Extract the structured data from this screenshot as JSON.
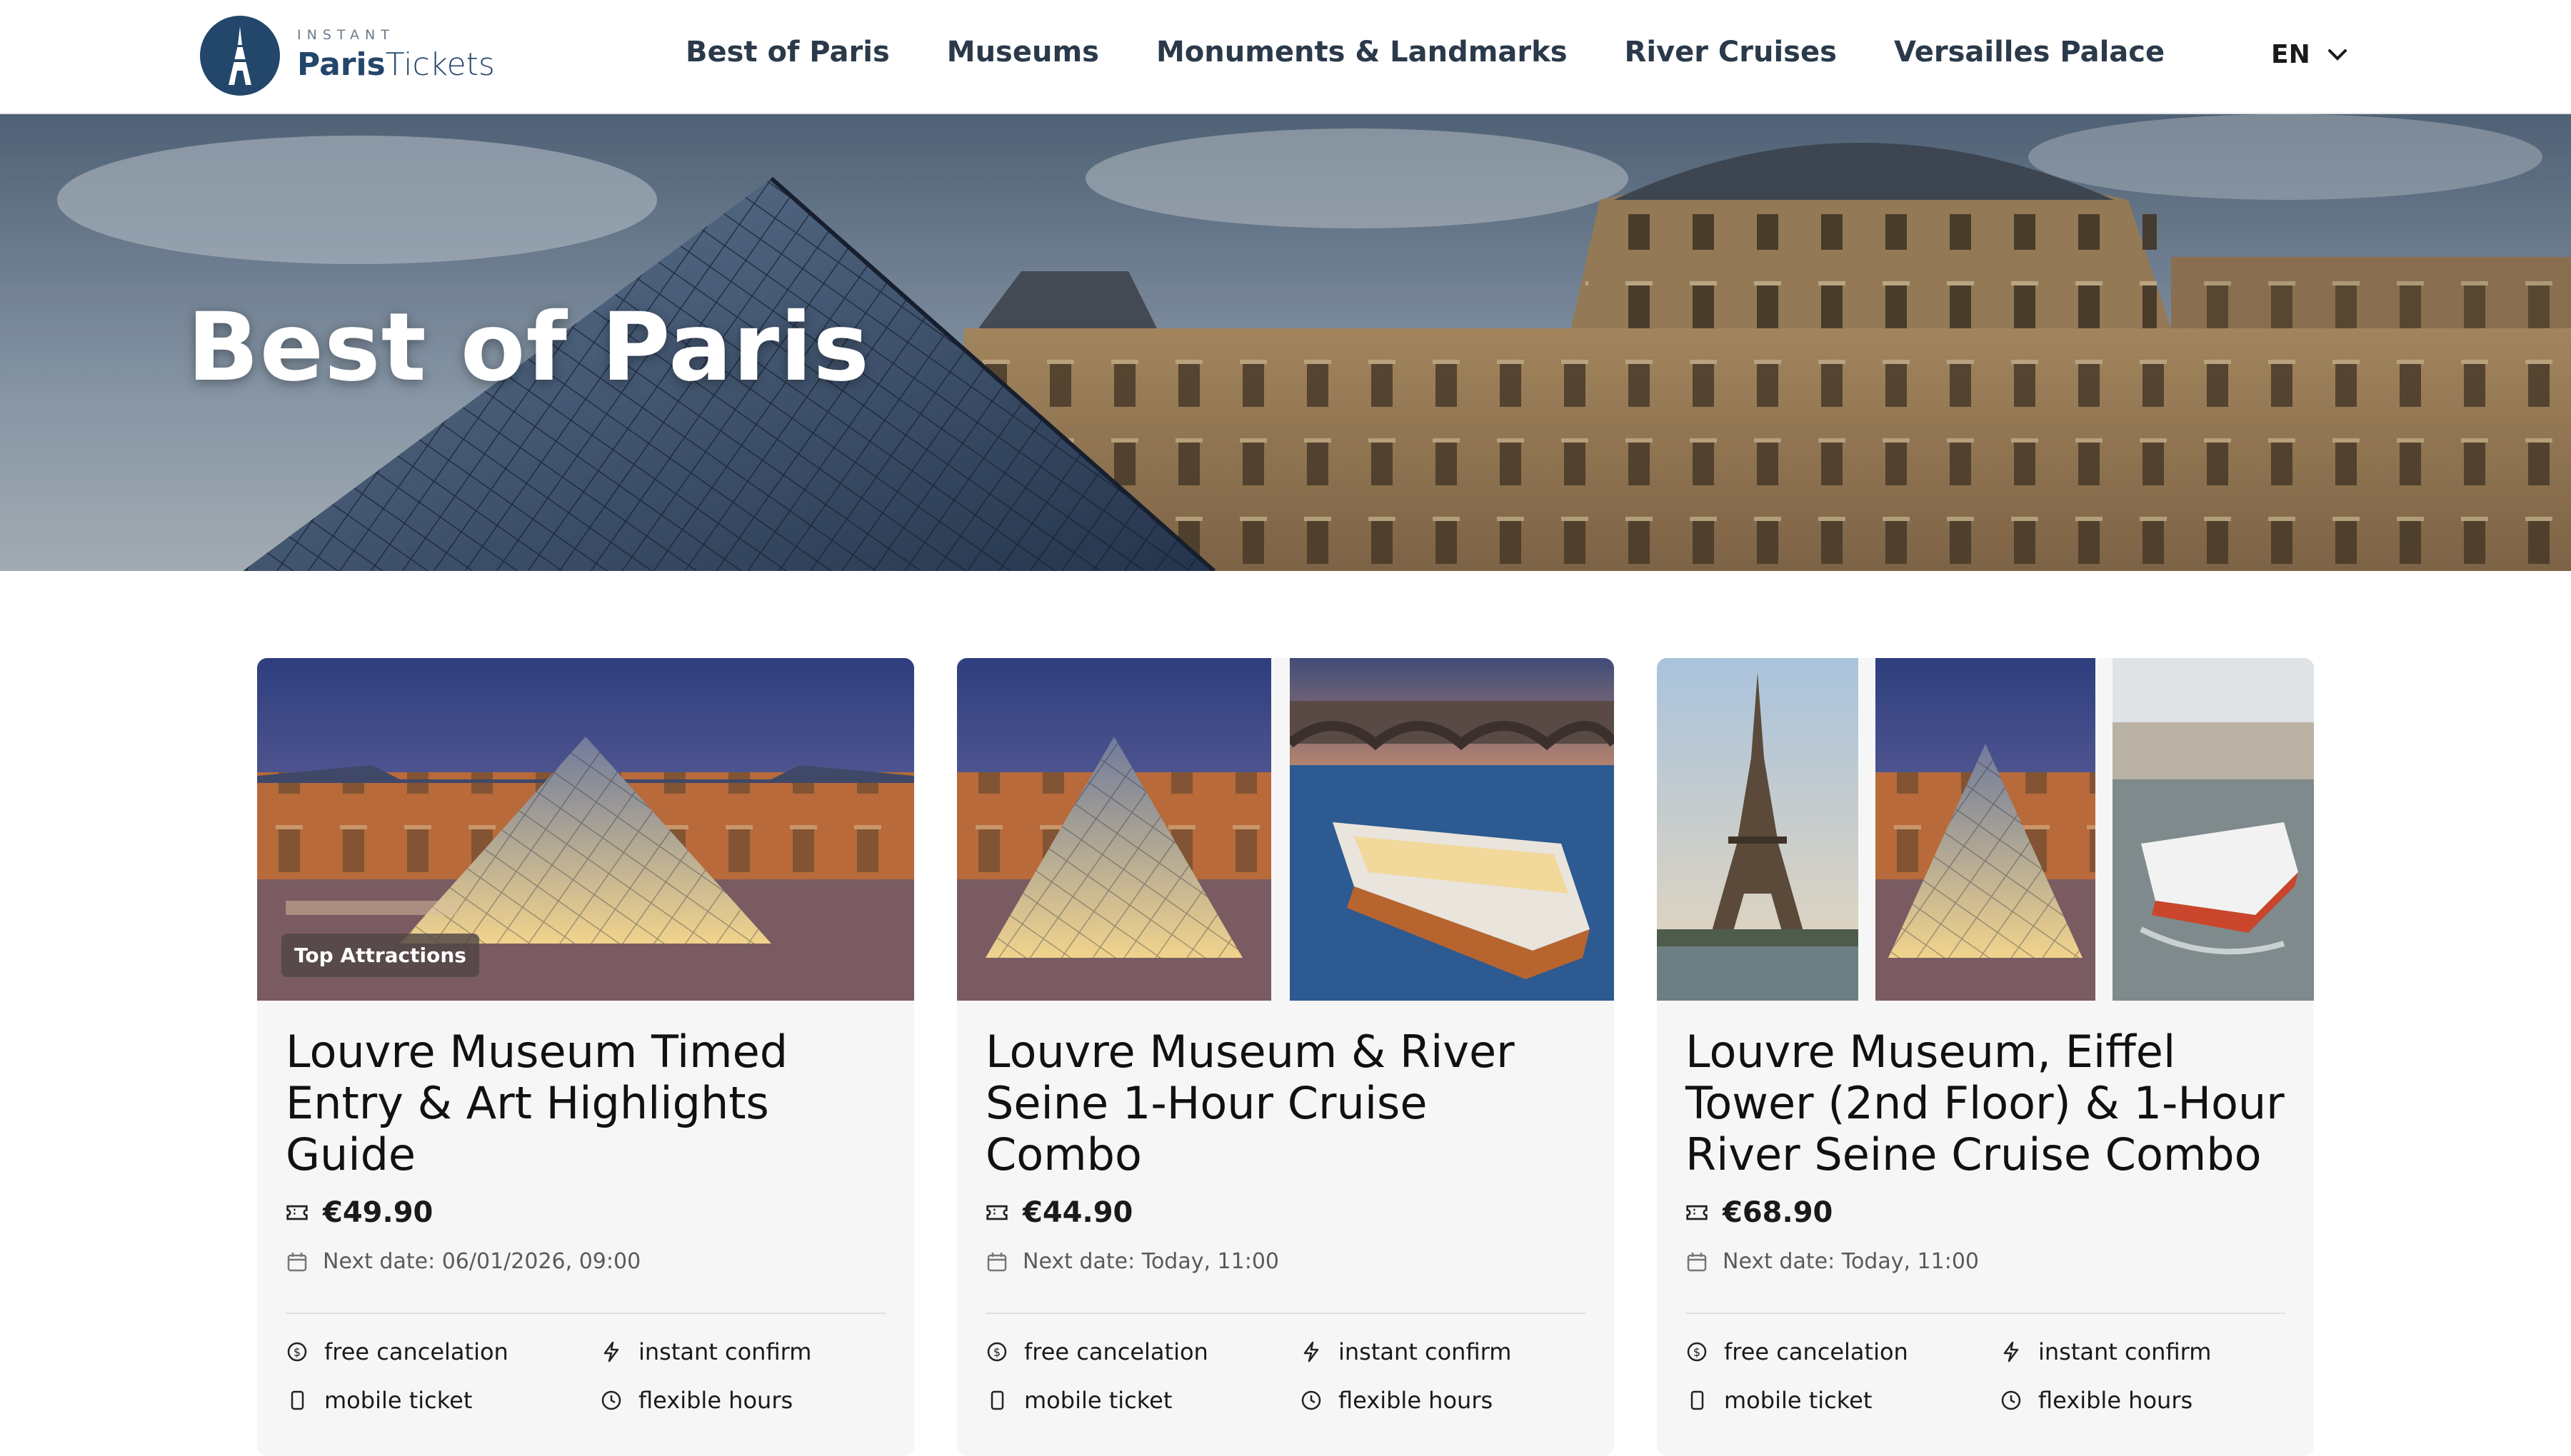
{
  "header": {
    "logo_small": "INSTANT",
    "logo_brand_bold": "Paris",
    "logo_brand_light": "Tickets",
    "nav": [
      "Best of Paris",
      "Museums",
      "Monuments & Landmarks",
      "River Cruises",
      "Versailles Palace"
    ],
    "language": "EN"
  },
  "hero": {
    "title": "Best of Paris"
  },
  "colors": {
    "brand": "#23466b",
    "card_bg": "#f6f6f6",
    "badge_bg": "#504646"
  },
  "cards": [
    {
      "badge": "Top Attractions",
      "title": "Louvre Museum Timed Entry & Art Highlights Guide",
      "price": "€49.90",
      "next_date": "Next date: 06/01/2026, 09:00",
      "features": [
        "free cancelation",
        "instant confirm",
        "mobile ticket",
        "flexible hours"
      ],
      "images": [
        "louvre-pyramid-night"
      ]
    },
    {
      "badge": "",
      "title": "Louvre Museum & River Seine 1-Hour Cruise Combo",
      "price": "€44.90",
      "next_date": "Next date: Today, 11:00",
      "features": [
        "free cancelation",
        "instant confirm",
        "mobile ticket",
        "flexible hours"
      ],
      "images": [
        "louvre-pyramid-night",
        "seine-cruise-boat"
      ]
    },
    {
      "badge": "",
      "title": "Louvre Museum, Eiffel Tower (2nd Floor) & 1-Hour River Seine Cruise Combo",
      "price": "€68.90",
      "next_date": "Next date: Today, 11:00",
      "features": [
        "free cancelation",
        "instant confirm",
        "mobile ticket",
        "flexible hours"
      ],
      "images": [
        "eiffel-tower",
        "louvre-pyramid-night",
        "seine-cruise-boat-day"
      ]
    }
  ],
  "icons": {
    "price": "ticket-icon",
    "date": "calendar-icon",
    "features": [
      "dollar-circle-icon",
      "lightning-icon",
      "phone-icon",
      "clock-icon"
    ]
  }
}
